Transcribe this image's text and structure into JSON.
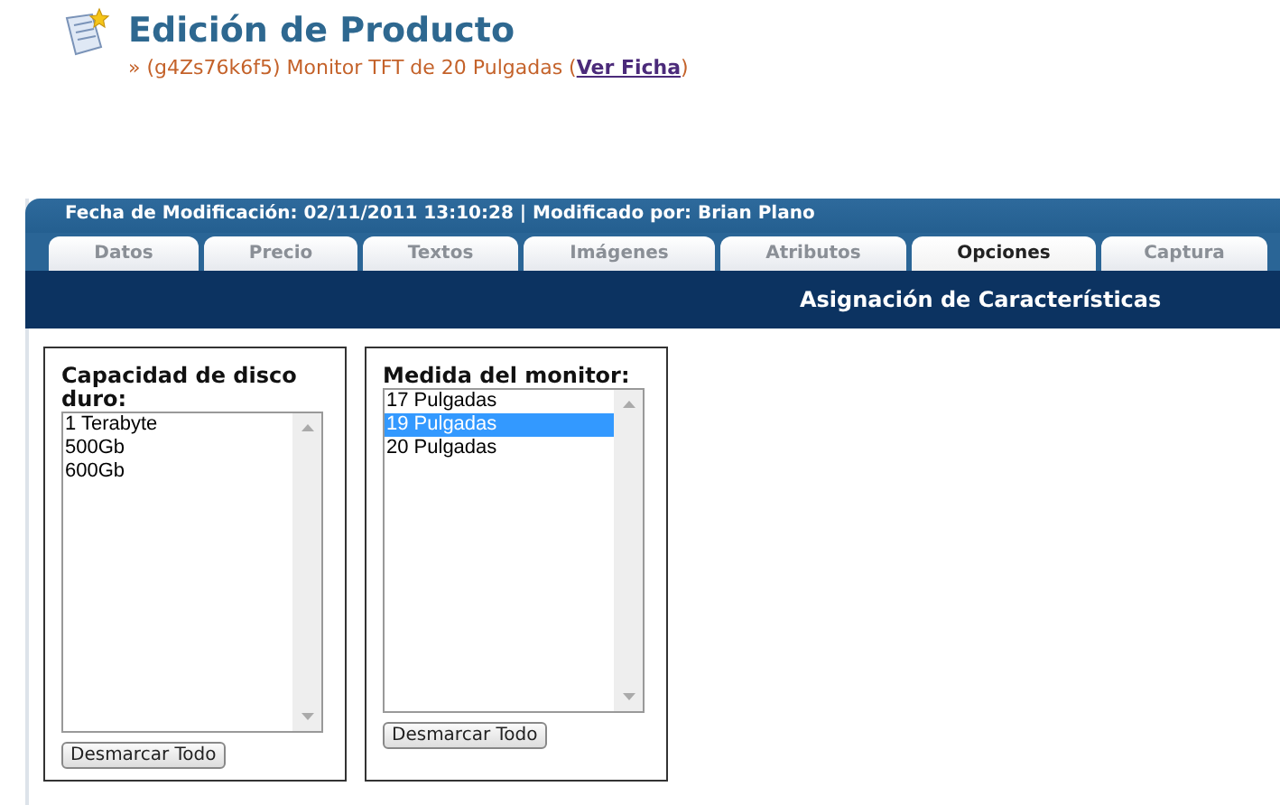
{
  "header": {
    "title": "Edición de Producto",
    "breadcrumb": {
      "prefix": "» (g4Zs76k6f5) Monitor TFT de 20 Pulgadas (",
      "link": "Ver Ficha",
      "suffix": ")"
    }
  },
  "panel": {
    "info": "Fecha de Modificación: 02/11/2011 13:10:28 | Modificado por: Brian Plano",
    "tabs": [
      {
        "label": "Datos",
        "selected": false
      },
      {
        "label": "Precio",
        "selected": false
      },
      {
        "label": "Textos",
        "selected": false
      },
      {
        "label": "Imágenes",
        "selected": false
      },
      {
        "label": "Atributos",
        "selected": false
      },
      {
        "label": "Opciones",
        "selected": true
      },
      {
        "label": "Captura",
        "selected": false
      }
    ],
    "section_title": "Asignación de Características",
    "groups": [
      {
        "label": "Capacidad de disco duro:",
        "options": [
          {
            "text": "1 Terabyte",
            "selected": false
          },
          {
            "text": "500Gb",
            "selected": false
          },
          {
            "text": "600Gb",
            "selected": false
          }
        ],
        "button": "Desmarcar Todo"
      },
      {
        "label": "Medida del monitor:",
        "options": [
          {
            "text": "17 Pulgadas",
            "selected": false
          },
          {
            "text": "19 Pulgadas",
            "selected": true
          },
          {
            "text": "20 Pulgadas",
            "selected": false
          }
        ],
        "button": "Desmarcar Todo"
      }
    ]
  }
}
